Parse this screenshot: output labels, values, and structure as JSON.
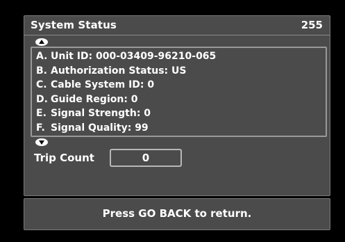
{
  "header": {
    "title": "System Status",
    "channel": "255"
  },
  "status_items": [
    {
      "letter": "A.",
      "text": "Unit ID:  000-03409-96210-065"
    },
    {
      "letter": "B.",
      "text": "Authorization Status:  US"
    },
    {
      "letter": "C.",
      "text": "Cable System ID:  0"
    },
    {
      "letter": "D.",
      "text": "Guide Region:  0"
    },
    {
      "letter": "E.",
      "text": "Signal Strength:  0"
    },
    {
      "letter": "F.",
      "text": "Signal Quality:  99"
    }
  ],
  "icons": {
    "scroll_up": "scroll-up-arrow-icon",
    "scroll_down": "scroll-down-arrow-icon"
  },
  "trip": {
    "label": "Trip Count",
    "value": "0"
  },
  "footer": {
    "text": "Press GO BACK to return."
  },
  "colors": {
    "background": "#000000",
    "panel": "#4b4b4b",
    "text": "#ffffff"
  }
}
